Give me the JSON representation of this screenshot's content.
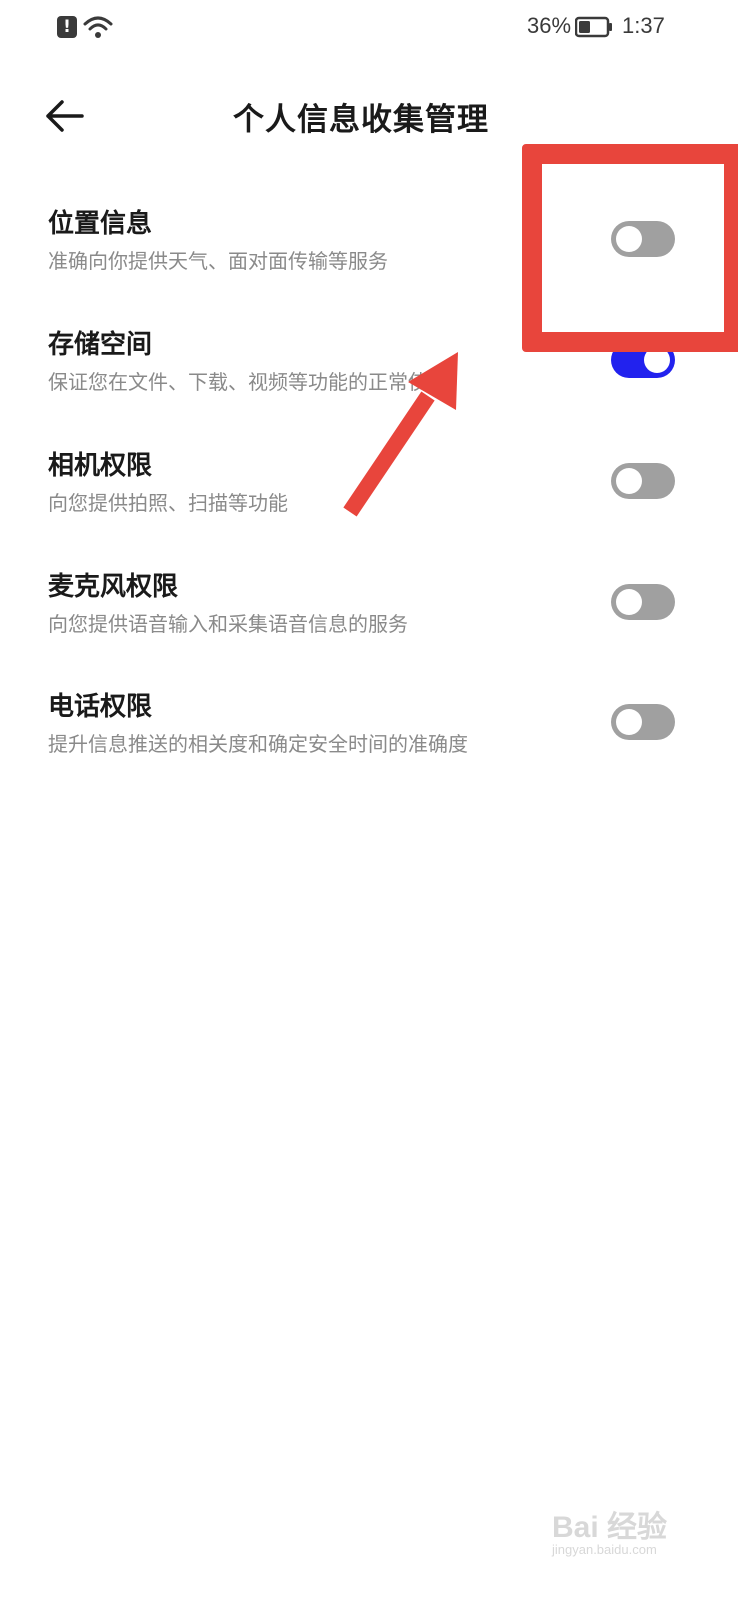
{
  "status_bar": {
    "battery_percent": "36%",
    "time": "1:37"
  },
  "header": {
    "title": "个人信息收集管理"
  },
  "settings": [
    {
      "title": "位置信息",
      "description": "准确向你提供天气、面对面传输等服务",
      "enabled": false
    },
    {
      "title": "存储空间",
      "description": "保证您在文件、下载、视频等功能的正常使用",
      "enabled": true
    },
    {
      "title": "相机权限",
      "description": "向您提供拍照、扫描等功能",
      "enabled": false
    },
    {
      "title": "麦克风权限",
      "description": "向您提供语音输入和采集语音信息的服务",
      "enabled": false
    },
    {
      "title": "电话权限",
      "description": "提升信息推送的相关度和确定安全时间的准确度",
      "enabled": false
    }
  ],
  "colors": {
    "toggle_on": "#2222ee",
    "toggle_off": "#a0a0a0",
    "annotation": "#e8453c"
  },
  "icons": {
    "back": "arrow-left-icon",
    "alert": "alert-icon",
    "wifi": "wifi-icon",
    "battery": "battery-icon"
  },
  "watermark": {
    "text": "Bai 经验",
    "url": "jingyan.baidu.com"
  }
}
